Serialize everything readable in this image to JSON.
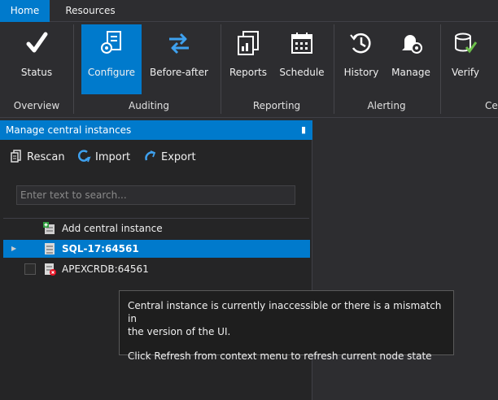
{
  "tabs": [
    {
      "label": "Home",
      "active": true
    },
    {
      "label": "Resources",
      "active": false
    }
  ],
  "ribbon": {
    "buttons": [
      {
        "label": "Status",
        "icon": "checkmark-icon"
      },
      {
        "label": "Configure",
        "icon": "configure-icon",
        "active": true
      },
      {
        "label": "Before-after",
        "icon": "swap-arrows-icon"
      },
      {
        "label": "Reports",
        "icon": "reports-icon"
      },
      {
        "label": "Schedule",
        "icon": "calendar-icon"
      },
      {
        "label": "History",
        "icon": "history-icon"
      },
      {
        "label": "Manage",
        "icon": "manage-alerts-icon"
      },
      {
        "label": "Verify",
        "icon": "verify-icon"
      }
    ],
    "groups": [
      "Overview",
      "Auditing",
      "Reporting",
      "Alerting",
      "Ce"
    ]
  },
  "panel": {
    "title": "Manage central instances",
    "toolbar": {
      "rescan": "Rescan",
      "import": "Import",
      "export": "Export"
    },
    "search_placeholder": "Enter text to search...",
    "tree": [
      {
        "label": "Add central instance",
        "icon": "add-server-icon"
      },
      {
        "label": "SQL-17:64561",
        "icon": "server-icon",
        "selected": true
      },
      {
        "label": "APEXCRDB:64561",
        "icon": "server-error-icon"
      }
    ]
  },
  "tooltip": {
    "line1": "Central instance is currently inaccessible or there is a mismatch in",
    "line2": "the version of the UI.",
    "line3": "Click Refresh from context menu to refresh current node state"
  },
  "colors": {
    "accent": "#007acc",
    "background": "#2d2d30",
    "panel": "#252526",
    "error": "#e81123",
    "verify_green": "#6cc04a"
  }
}
